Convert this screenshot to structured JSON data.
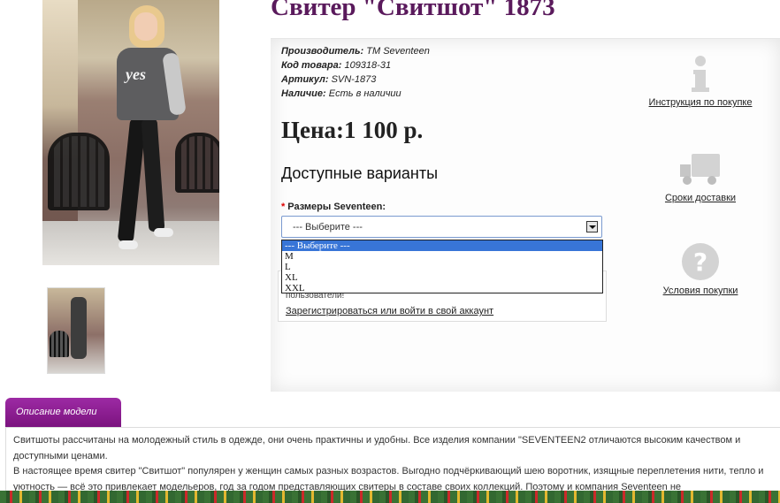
{
  "product": {
    "title": "Свитер \"Свитшот\" 1873",
    "photo_text": "yes",
    "meta": [
      {
        "label": "Производитель:",
        "value": "TM Seventeen"
      },
      {
        "label": "Код товара:",
        "value": "109318-31"
      },
      {
        "label": "Артикул:",
        "value": "SVN-1873"
      },
      {
        "label": "Наличие:",
        "value": "Есть в наличии"
      }
    ],
    "price": "Цена:1 100 р.",
    "variants_heading": "Доступные варианты",
    "size_label": "Размеры Seventeen:",
    "required_mark": "*",
    "select": {
      "value": "--- Выберите ---",
      "options": [
        "--- Выберите ---",
        "M",
        "L",
        "XL",
        "XXL"
      ]
    },
    "login": {
      "message": "пользователи!",
      "link": "Зарегистрироваться или войти в свой аккаунт"
    }
  },
  "sidebar": {
    "instructions": "Инструкция по покупке",
    "delivery": "Сроки доставки",
    "terms": "Условия покупки"
  },
  "description": {
    "tab_label": "Описание модели",
    "p1": "Свитшоты рассчитаны на молодежный стиль в одежде, они очень практичны и удобны. Все изделия компании \"SEVENTEEN2 отличаются высоким качеством и доступными ценами.",
    "p2": "В настоящее время свитер \"Свитшот\" популярен у женщин самых разных возрастов. Выгодно подчёркивающий шею воротник, изящные переплетения нити, тепло и уютность — всё это привлекает модельеров, год за годом представляющих свитеры в составе своих коллекций. Поэтому и компания Seventeen не"
  },
  "colors": {
    "title": "#5a1a5c",
    "tab": "#8a1d8f",
    "selected_option": "#3875d7"
  },
  "icons": [
    "info-icon",
    "truck-icon",
    "question-icon",
    "dropdown-arrow-icon"
  ]
}
